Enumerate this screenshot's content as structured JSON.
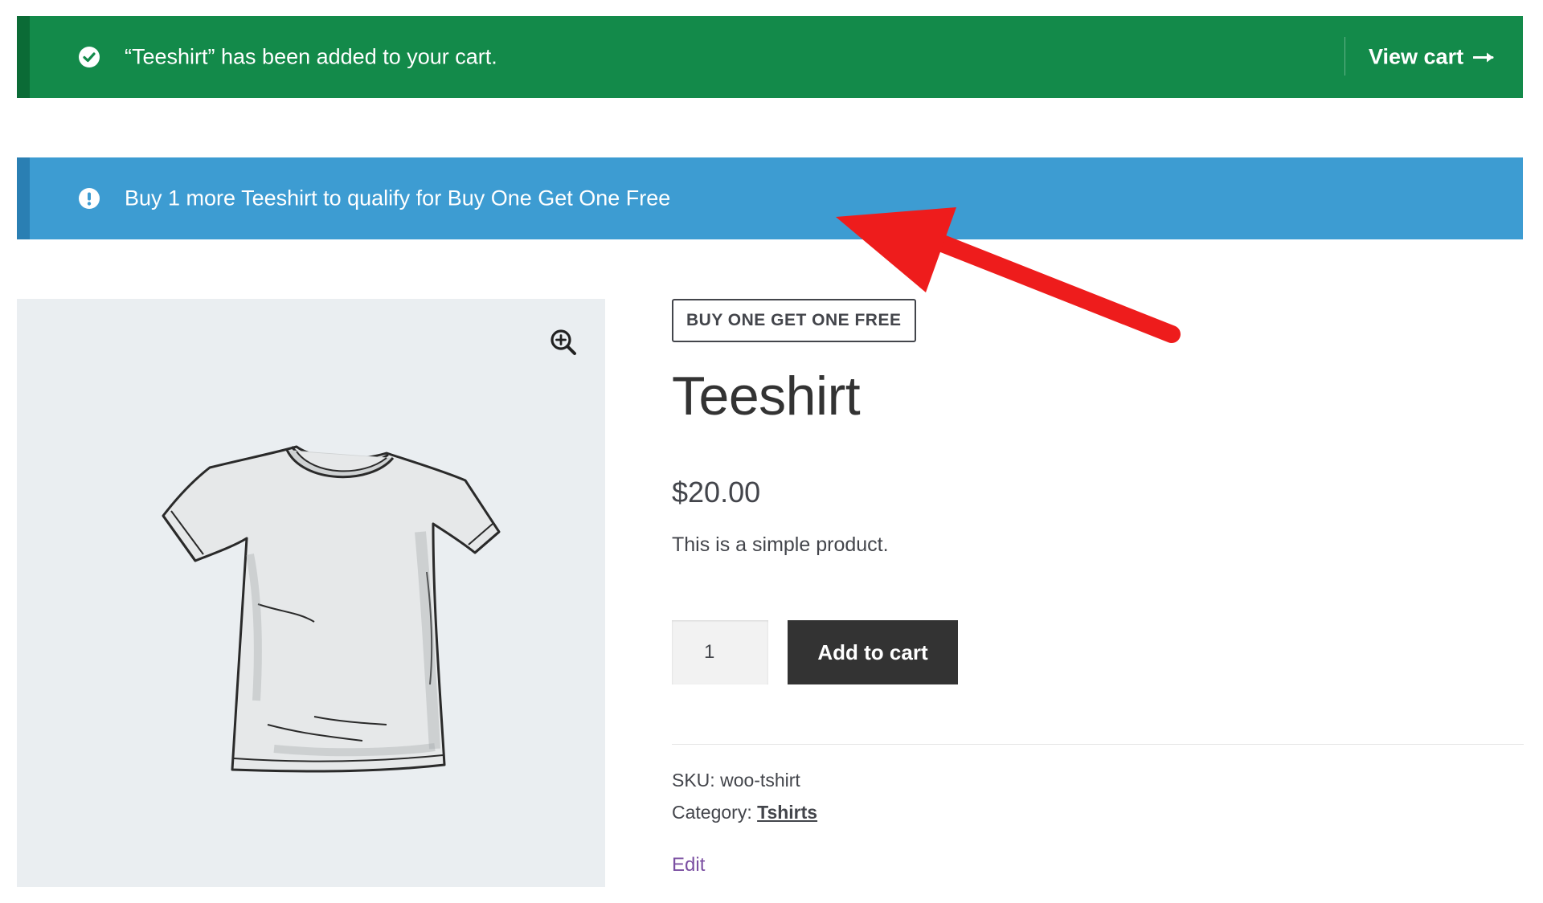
{
  "notices": {
    "success": {
      "message": "“Teeshirt” has been added to your cart.",
      "action_label": "View cart",
      "icon": "check-circle-icon",
      "color": "#138a4a"
    },
    "info": {
      "message": "Buy 1 more Teeshirt to qualify for Buy One Get One Free",
      "icon": "exclamation-circle-icon",
      "color": "#3d9cd2"
    }
  },
  "product": {
    "badge": "BUY ONE GET ONE FREE",
    "title": "Teeshirt",
    "price": "$20.00",
    "short_description": "This is a simple product.",
    "quantity": "1",
    "add_to_cart_label": "Add to cart",
    "meta": {
      "sku_label": "SKU:",
      "sku_value": "woo-tshirt",
      "category_label": "Category:",
      "category_value": "Tshirts"
    },
    "edit_label": "Edit",
    "image_icon": "tshirt-illustration",
    "zoom_icon": "zoom-in-icon"
  },
  "annotation": {
    "icon": "red-pointer-arrow",
    "color": "#ee1c1c"
  }
}
